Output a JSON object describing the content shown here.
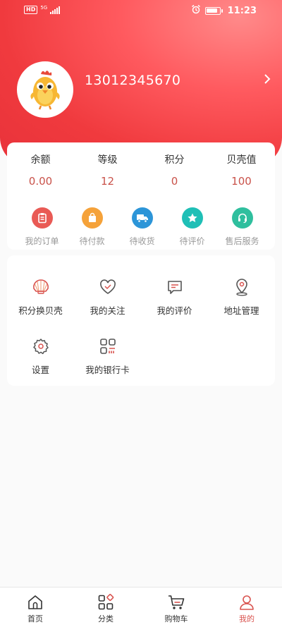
{
  "status_bar": {
    "network": "HD",
    "signal_label": "5G",
    "time": "11:23"
  },
  "profile": {
    "phone": "13012345670"
  },
  "stats": [
    {
      "label": "余额",
      "value": "0.00"
    },
    {
      "label": "等级",
      "value": "12"
    },
    {
      "label": "积分",
      "value": "0"
    },
    {
      "label": "贝壳值",
      "value": "100"
    }
  ],
  "orders": [
    {
      "label": "我的订单",
      "icon": "clipboard-icon",
      "color": "#e95a55"
    },
    {
      "label": "待付款",
      "icon": "shopping-bag-icon",
      "color": "#f5a23a"
    },
    {
      "label": "待收货",
      "icon": "truck-icon",
      "color": "#2c95d8"
    },
    {
      "label": "待评价",
      "icon": "star-icon",
      "color": "#1fbfb6"
    },
    {
      "label": "售后服务",
      "icon": "headset-icon",
      "color": "#2fbf9e"
    }
  ],
  "menu": [
    {
      "label": "积分换贝壳",
      "icon": "shell-icon"
    },
    {
      "label": "我的关注",
      "icon": "heart-icon"
    },
    {
      "label": "我的评价",
      "icon": "comment-icon"
    },
    {
      "label": "地址管理",
      "icon": "location-pin-icon"
    },
    {
      "label": "设置",
      "icon": "gear-icon"
    },
    {
      "label": "我的银行卡",
      "icon": "bank-card-icon"
    }
  ],
  "tabs": [
    {
      "label": "首页",
      "icon": "home-icon"
    },
    {
      "label": "分类",
      "icon": "category-icon"
    },
    {
      "label": "购物车",
      "icon": "cart-icon"
    },
    {
      "label": "我的",
      "icon": "user-icon",
      "active": true
    }
  ],
  "colors": {
    "accent": "#e8323a",
    "value_red": "#c9524a",
    "active_tab": "#d9534f"
  }
}
